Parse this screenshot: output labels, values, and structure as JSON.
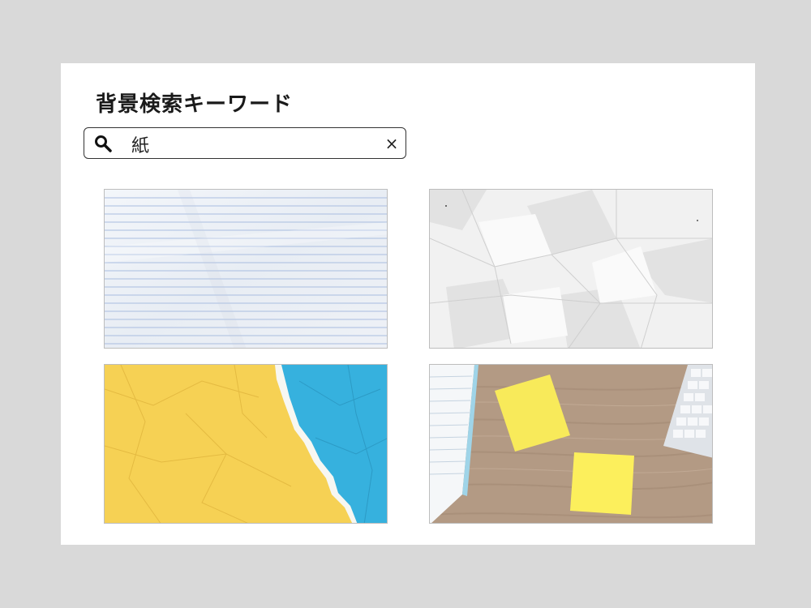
{
  "page": {
    "title": "背景検索キーワード"
  },
  "search": {
    "query": "紙",
    "icon": "search-icon",
    "clear_icon": "close-icon",
    "clear_label": "×"
  },
  "results": [
    {
      "name": "lined-notebook-paper"
    },
    {
      "name": "crumpled-white-paper"
    },
    {
      "name": "torn-yellow-blue-paper"
    },
    {
      "name": "sticky-notes-on-desk"
    }
  ],
  "colors": {
    "frame": "#d9d9d9",
    "panel": "#ffffff",
    "lined_paper": "#eef2f7",
    "ruling": "#9fb3da",
    "yellow_paper": "#f7d357",
    "blue_paper": "#35b0dd",
    "desk_wood": "#b59a83",
    "sticky_note": "#fbef5a"
  }
}
